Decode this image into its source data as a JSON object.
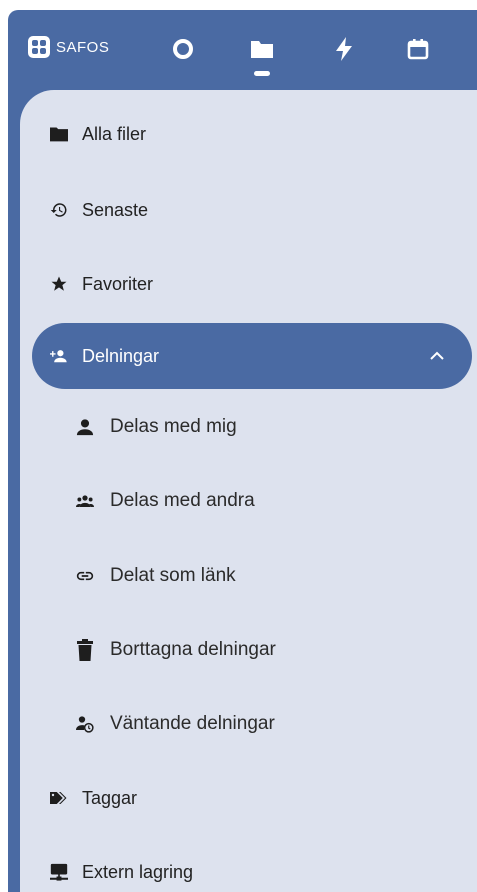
{
  "brand": {
    "name": "SAFOS"
  },
  "topbar": {
    "apps": [
      {
        "icon": "circle-icon"
      },
      {
        "icon": "folder-icon",
        "active": true
      },
      {
        "icon": "lightning-icon"
      },
      {
        "icon": "calendar-icon"
      }
    ]
  },
  "nav": {
    "all_files": "Alla filer",
    "recent": "Senaste",
    "favorites": "Favoriter",
    "shares": "Delningar",
    "shared_with_me": "Delas med mig",
    "shared_with_others": "Delas med andra",
    "shared_by_link": "Delat som länk",
    "deleted_shares": "Borttagna delningar",
    "pending_shares": "Väntande delningar",
    "tags": "Taggar",
    "external_storage": "Extern lagring"
  },
  "colors": {
    "accent": "#4a6aa3",
    "panel": "#dde2ee"
  }
}
